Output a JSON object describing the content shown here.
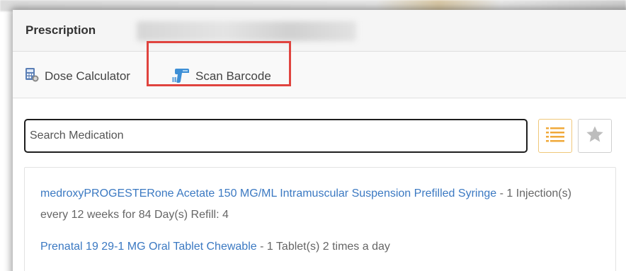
{
  "dialog": {
    "title": "Prescription"
  },
  "toolbar": {
    "dose_calculator_label": "Dose Calculator",
    "scan_barcode_label": "Scan Barcode"
  },
  "search": {
    "placeholder": "Search Medication",
    "value": ""
  },
  "results": [
    {
      "name": "medroxyPROGESTERone Acetate 150 MG/ML Intramuscular Suspension Prefilled Syringe",
      "directions": " - 1 Injection(s) every 12 weeks for 84 Day(s) Refill: 4"
    },
    {
      "name": "Prenatal 19 29-1 MG Oral Tablet Chewable",
      "directions": " - 1 Tablet(s) 2 times a day"
    }
  ],
  "icons": {
    "dose_calculator": "calculator-icon",
    "scan_barcode": "barcode-scanner-icon",
    "list_view": "list-icon",
    "favorites": "star-icon"
  },
  "colors": {
    "link": "#3b79c2",
    "highlight": "#e0443f",
    "list_button_accent": "#f0a93a",
    "star": "#bdbdbd"
  }
}
